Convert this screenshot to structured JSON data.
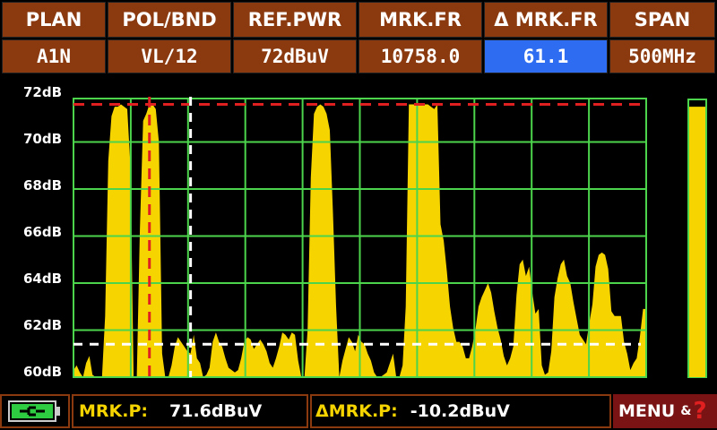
{
  "header": {
    "labels": [
      "PLAN",
      "POL/BND",
      "REF.PWR",
      "MRK.FR",
      "Δ MRK.FR",
      "SPAN"
    ],
    "values": [
      "A1N",
      "VL/12",
      "72dBuV",
      "10758.0",
      "61.1",
      "500MHz"
    ]
  },
  "y_axis": {
    "labels": [
      "72dB",
      "70dB",
      "68dB",
      "66dB",
      "64dB",
      "62dB",
      "60dB"
    ]
  },
  "chart_data": {
    "type": "area",
    "ylim": [
      60,
      72
    ],
    "grid": true,
    "reference_level_dB": 71.6,
    "marker_level_dB": 61.4,
    "values": [
      60.3,
      60.5,
      60.2,
      60.0,
      60.6,
      60.9,
      60.1,
      60.0,
      60.0,
      60.0,
      62.6,
      69.2,
      71.1,
      71.5,
      71.5,
      71.6,
      71.5,
      71.4,
      69.0,
      60.0,
      60.0,
      66.3,
      70.9,
      71.2,
      71.6,
      71.6,
      71.4,
      70.0,
      61.0,
      60.0,
      60.0,
      60.5,
      61.3,
      61.7,
      61.5,
      61.3,
      61.1,
      61.0,
      61.8,
      60.8,
      60.6,
      60.0,
      60.1,
      60.4,
      61.5,
      61.9,
      61.5,
      61.3,
      60.8,
      60.4,
      60.3,
      60.2,
      60.3,
      60.8,
      61.5,
      61.7,
      61.6,
      61.2,
      61.4,
      61.6,
      61.4,
      61.1,
      60.6,
      60.4,
      60.8,
      61.3,
      61.9,
      61.8,
      61.6,
      61.9,
      61.8,
      60.7,
      60.0,
      60.0,
      62.0,
      68.5,
      71.2,
      71.5,
      71.6,
      71.5,
      71.2,
      70.5,
      67.0,
      63.0,
      60.0,
      60.7,
      61.2,
      61.7,
      61.5,
      61.1,
      61.8,
      61.5,
      61.4,
      61.0,
      60.7,
      60.2,
      60.0,
      60.0,
      60.1,
      60.2,
      60.6,
      61.0,
      60.0,
      60.0,
      60.5,
      63.0,
      71.6,
      71.6,
      71.6,
      71.6,
      71.6,
      71.6,
      71.6,
      71.5,
      71.4,
      71.6,
      66.5,
      65.8,
      64.5,
      63.0,
      62.1,
      61.5,
      61.5,
      61.3,
      60.8,
      60.8,
      61.3,
      62.0,
      63.0,
      63.4,
      63.7,
      64.0,
      63.6,
      62.8,
      62.1,
      61.6,
      60.9,
      60.5,
      60.8,
      61.3,
      63.5,
      64.8,
      65.0,
      64.3,
      64.7,
      63.6,
      62.7,
      62.9,
      60.5,
      60.1,
      60.2,
      61.1,
      63.4,
      64.2,
      64.8,
      65.0,
      64.3,
      64.0,
      63.2,
      62.5,
      61.8,
      61.6,
      61.4,
      62.3,
      63.1,
      64.7,
      65.2,
      65.3,
      65.2,
      64.6,
      62.8,
      62.6,
      62.6,
      62.6,
      61.5,
      61.0,
      60.3,
      60.6,
      60.8,
      61.7,
      62.9,
      62.9
    ]
  },
  "level_bar": {
    "value_dB": 71.5
  },
  "footer": {
    "battery_icon": "battery-charging-icon",
    "mrk_p_label": "MRK.P:",
    "mrk_p_value": "71.6dBuV",
    "dmrk_p_label": "ΔMRK.P:",
    "dmrk_p_value": "-10.2dBuV",
    "menu_label": "MENU",
    "menu_amp": "&",
    "menu_q": "?"
  },
  "colors": {
    "trace": "#f5d400",
    "grid": "#4cd44c",
    "ref_line": "#e02020",
    "marker": "#ffffff",
    "header_bg": "#8b3a10",
    "active_cell": "#2e6cf2"
  }
}
